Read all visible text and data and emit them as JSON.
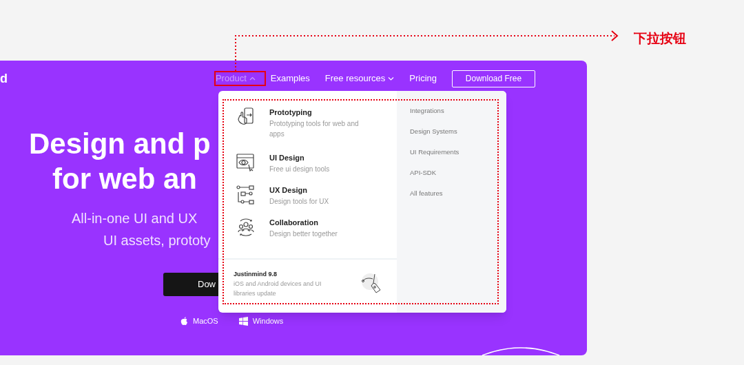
{
  "annotation": {
    "label": "下拉按钮"
  },
  "logo_fragment": "d",
  "nav": [
    {
      "kind": "dropdown",
      "label": "Product",
      "expanded": true,
      "selected": true
    },
    {
      "kind": "link",
      "label": "Examples",
      "selected": false
    },
    {
      "kind": "dropdown",
      "label": "Free resources",
      "expanded": false,
      "selected": false
    },
    {
      "kind": "link",
      "label": "Pricing",
      "selected": false
    }
  ],
  "cta_button": "Download Free",
  "hero": {
    "title_lines": [
      "Design and p",
      "for web an"
    ],
    "subtitle_lines": [
      "All-in-one UI and UX",
      "UI assets, prototy"
    ],
    "download_button": "Dow",
    "platforms": [
      {
        "kind": "apple",
        "label": "MacOS"
      },
      {
        "kind": "windows",
        "label": "Windows"
      }
    ]
  },
  "dropdown": {
    "products": [
      {
        "kind": "prototyping",
        "title": "Prototyping",
        "description": "Prototyping tools for web and apps"
      },
      {
        "kind": "ui",
        "title": "UI Design",
        "description": "Free ui design tools"
      },
      {
        "kind": "ux",
        "title": "UX Design",
        "description": "Design tools for UX"
      },
      {
        "kind": "collaboration",
        "title": "Collaboration",
        "description": "Design better together"
      }
    ],
    "release": {
      "title": "Justinmind 9.8",
      "description": "iOS and Android devices and UI libraries update"
    },
    "links": [
      "Integrations",
      "Design Systems",
      "UI Requirements",
      "API-SDK",
      "All features"
    ]
  }
}
